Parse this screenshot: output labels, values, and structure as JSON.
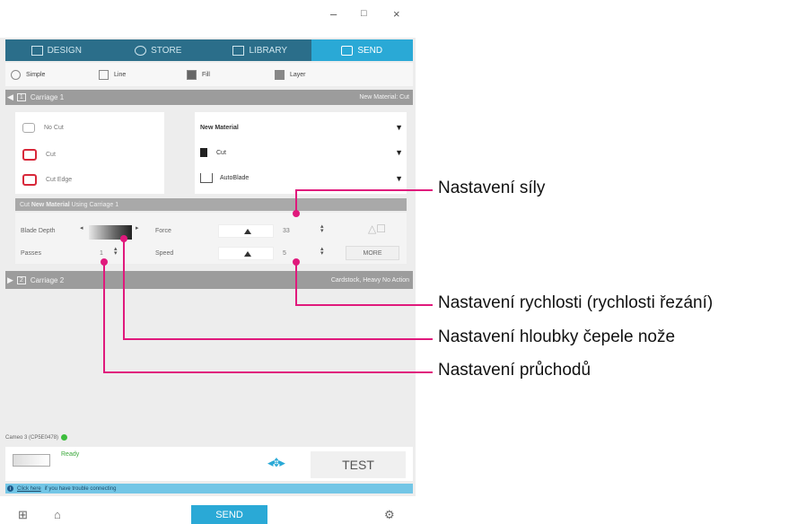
{
  "window": {
    "minimize": "–",
    "maximize": "□",
    "close": "×"
  },
  "tabs": [
    {
      "label": "DESIGN",
      "icon": "design-icon"
    },
    {
      "label": "STORE",
      "icon": "store-icon"
    },
    {
      "label": "LIBRARY",
      "icon": "library-icon"
    },
    {
      "label": "SEND",
      "icon": "send-icon",
      "active": true
    }
  ],
  "subtabs": [
    {
      "label": "Simple",
      "icon": "simple-icon"
    },
    {
      "label": "Line",
      "icon": "line-icon"
    },
    {
      "label": "Fill",
      "icon": "fill-icon"
    },
    {
      "label": "Layer",
      "icon": "layer-icon"
    }
  ],
  "carriage1": {
    "number": "1",
    "label": "Carriage 1",
    "right": "New Material: Cut"
  },
  "cut_options": [
    {
      "label": "No Cut",
      "active": false
    },
    {
      "label": "Cut",
      "active": true
    },
    {
      "label": "Cut Edge",
      "active": true
    }
  ],
  "dropdowns": [
    {
      "value": "New Material",
      "icon": ""
    },
    {
      "value": "Cut",
      "icon": "action-icon"
    },
    {
      "value": "AutoBlade",
      "icon": "blade-icon"
    }
  ],
  "cutbar": {
    "prefix": "Cut",
    "material": "New Material",
    "suffix": "Using Carriage 1"
  },
  "settings": {
    "blade_depth_label": "Blade Depth",
    "passes_label": "Passes",
    "passes_value": "1",
    "force_label": "Force",
    "force_value": "33",
    "speed_label": "Speed",
    "speed_value": "5",
    "more_button": "MORE"
  },
  "carriage2": {
    "number": "2",
    "label": "Carriage 2",
    "right": "Cardstock, Heavy No Action"
  },
  "device": {
    "name": "Cameo 3 (CP5E0478)",
    "status": "Ready",
    "test_button": "TEST"
  },
  "info": {
    "link": "Click here",
    "text": "if you have trouble connecting"
  },
  "send_button": "SEND",
  "callouts": [
    "Nastavení síly",
    "Nastavení rychlosti (rychlosti řezání)",
    "Nastavení hloubky čepele nože",
    "Nastavení průchodů"
  ],
  "colors": {
    "accent": "#2aa9d6",
    "callout_line": "#e0197c",
    "cut_red": "#d8283a"
  }
}
